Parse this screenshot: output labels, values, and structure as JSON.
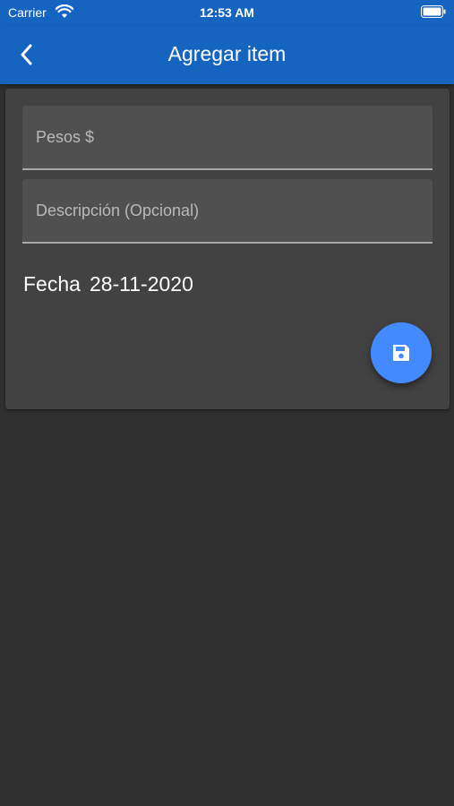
{
  "status_bar": {
    "carrier": "Carrier",
    "time": "12:53 AM"
  },
  "app_bar": {
    "title": "Agregar item",
    "back_icon": "chevron-left-icon"
  },
  "form": {
    "pesos_placeholder": "Pesos $",
    "descripcion_placeholder": "Descripción (Opcional)",
    "fecha_label": "Fecha",
    "fecha_value": "28-11-2020"
  },
  "fab": {
    "icon": "save-icon"
  },
  "colors": {
    "app_bar": "#1565c0",
    "background": "#303030",
    "card": "#424242",
    "field": "#505050",
    "fab": "#448aff"
  }
}
